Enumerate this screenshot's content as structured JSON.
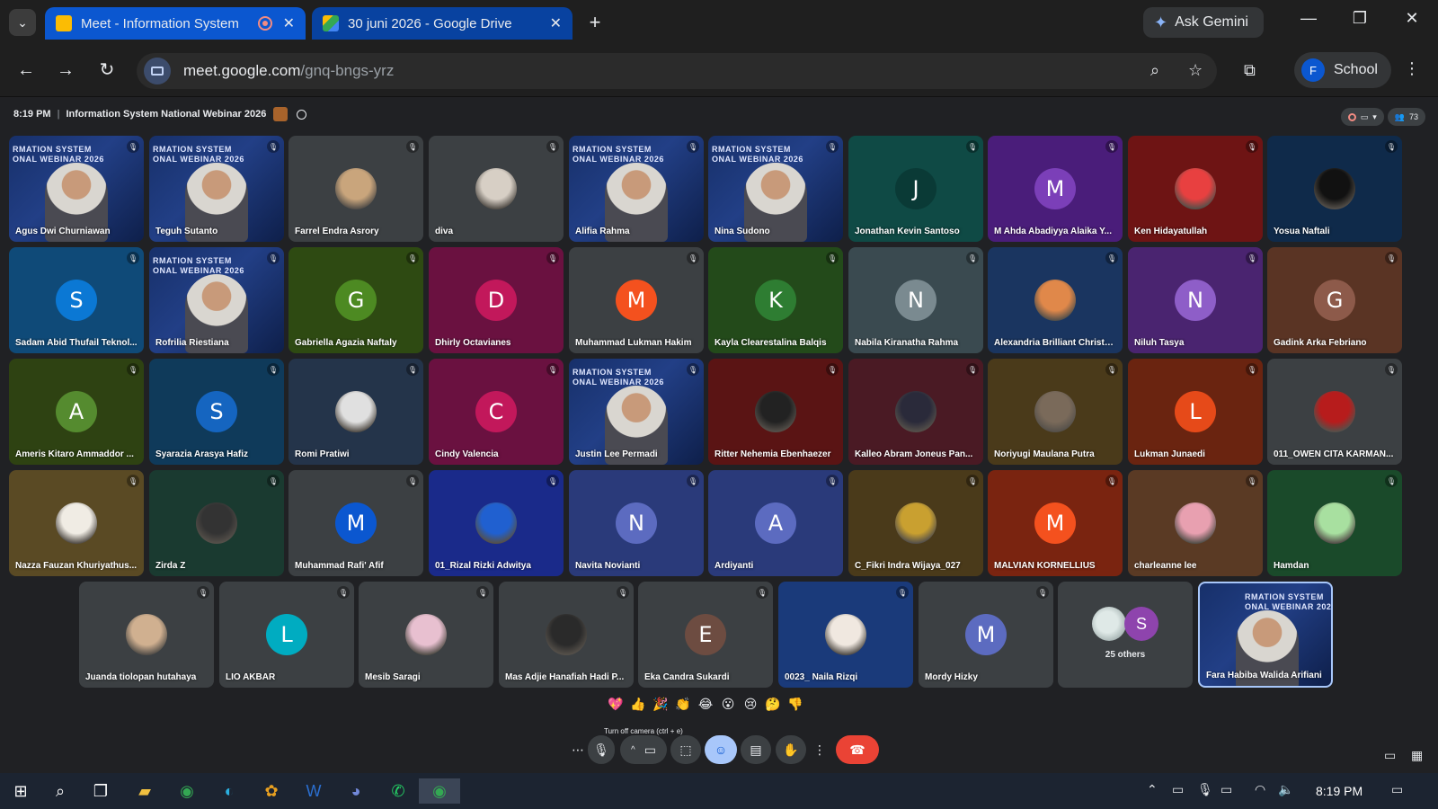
{
  "browser": {
    "tabs": [
      {
        "title": "Meet - Information System",
        "favicon_color": "#fbbc04"
      },
      {
        "title": "30 juni 2026 - Google Drive",
        "favicon_color": "#34a853"
      }
    ],
    "ask_gemini": "Ask Gemini",
    "url_host": "meet.google.com",
    "url_path": "/gnq-bngs-yrz",
    "profile_initial": "F",
    "profile_name": "School",
    "icons": {
      "back": "←",
      "forward": "→",
      "reload": "↻",
      "zoom": "⌕",
      "star": "☆",
      "extensions": "⧉",
      "menu": "⋮",
      "close": "✕",
      "newtab": "+",
      "minimize": "—",
      "restore": "❐"
    }
  },
  "meeting": {
    "time": "8:19 PM",
    "title": "Information System National Webinar 2026",
    "participant_count": "73"
  },
  "video_banner": "RMATION SYSTEM\nONAL WEBINAR 2026",
  "tiles": [
    {
      "name": "Agus Dwi Churniawan",
      "type": "video",
      "bg": "#1d3a7a"
    },
    {
      "name": "Teguh Sutanto",
      "type": "video",
      "bg": "#1d3a7a"
    },
    {
      "name": "Farrel Endra Asrory",
      "type": "photo",
      "bg": "#3c4043",
      "color": "#c9a57c"
    },
    {
      "name": "diva",
      "type": "photo",
      "bg": "#3c4043",
      "color": "#d7cfc5"
    },
    {
      "name": "Alifia Rahma",
      "type": "video",
      "bg": "#1d3a7a"
    },
    {
      "name": "Nina Sudono",
      "type": "video",
      "bg": "#1d3a7a"
    },
    {
      "name": "Jonathan Kevin Santoso",
      "type": "letter",
      "letter": "J",
      "bg": "#0f4a45",
      "color": "#0a3a36"
    },
    {
      "name": "M Ahda Abadiyya Alaika Y...",
      "type": "letter",
      "letter": "M",
      "bg": "#4a1d7a",
      "color": "#7b3fb8"
    },
    {
      "name": "Ken Hidayatullah",
      "type": "photo",
      "bg": "#6e1414",
      "color": "#e84040"
    },
    {
      "name": "Yosua Naftali",
      "type": "photo",
      "bg": "#0f2a4a",
      "color": "#111111"
    },
    {
      "name": "Sadam Abid Thufail Teknol...",
      "type": "letter",
      "letter": "S",
      "bg": "#0f4a78",
      "color": "#0b78d4"
    },
    {
      "name": "Rofrilia Riestiana",
      "type": "video",
      "bg": "#1d3a7a"
    },
    {
      "name": "Gabriella Agazia Naftaly",
      "type": "letter",
      "letter": "G",
      "bg": "#2e4a12",
      "color": "#4d8a22"
    },
    {
      "name": "Dhirly Octavianes",
      "type": "letter",
      "letter": "D",
      "bg": "#6a1140",
      "color": "#c2185b"
    },
    {
      "name": "Muhammad Lukman Hakim",
      "type": "letter",
      "letter": "M",
      "bg": "#3c4043",
      "color": "#f4511e"
    },
    {
      "name": "Kayla Clearestalina Balqis",
      "type": "letter",
      "letter": "K",
      "bg": "#234a1a",
      "color": "#2e7d32"
    },
    {
      "name": "Nabila Kiranatha Rahma",
      "type": "letter",
      "letter": "N",
      "bg": "#3a4a50",
      "color": "#7a8a90"
    },
    {
      "name": "Alexandria Brilliant Christo...",
      "type": "photo",
      "bg": "#1a3560",
      "color": "#e0884a"
    },
    {
      "name": "Niluh Tasya",
      "type": "letter",
      "letter": "N",
      "bg": "#4a2470",
      "color": "#8e5ec8"
    },
    {
      "name": "Gadink Arka Febriano",
      "type": "letter",
      "letter": "G",
      "bg": "#5a3424",
      "color": "#8d5a4a"
    },
    {
      "name": "Ameris Kitaro Ammaddor ...",
      "type": "letter",
      "letter": "A",
      "bg": "#2e4212",
      "color": "#558b2f"
    },
    {
      "name": "Syarazia Arasya Hafiz",
      "type": "letter",
      "letter": "S",
      "bg": "#0f3a5a",
      "color": "#1565c0"
    },
    {
      "name": "Romi Pratiwi",
      "type": "photo",
      "bg": "#24344a",
      "color": "#e0e0e0"
    },
    {
      "name": "Cindy Valencia",
      "type": "letter",
      "letter": "C",
      "bg": "#6a1140",
      "color": "#c2185b"
    },
    {
      "name": "Justin Lee Permadi",
      "type": "video",
      "bg": "#1d3a7a"
    },
    {
      "name": "Ritter Nehemia Ebenhaezer",
      "type": "photo",
      "bg": "#5a1414",
      "color": "#222222"
    },
    {
      "name": "Kalleo Abram Joneus Pan...",
      "type": "photo",
      "bg": "#4a1a24",
      "color": "#2a2a3a"
    },
    {
      "name": "Noriyugi Maulana Putra",
      "type": "photo",
      "bg": "#4a3a1a",
      "color": "#7a6a5a"
    },
    {
      "name": "Lukman Junaedi",
      "type": "letter",
      "letter": "L",
      "bg": "#6a2410",
      "color": "#e64a19"
    },
    {
      "name": "011_OWEN CITA KARMAN...",
      "type": "photo",
      "bg": "#3c4043",
      "color": "#b71c1c"
    },
    {
      "name": "Nazza Fauzan Khuriyathus...",
      "type": "photo",
      "bg": "#5a4a24",
      "color": "#f0ece4"
    },
    {
      "name": "Zirda Z",
      "type": "photo",
      "bg": "#1a3a30",
      "color": "#333333"
    },
    {
      "name": "Muhammad Rafi' Afif",
      "type": "letter",
      "letter": "M",
      "bg": "#3c4043",
      "color": "#0b57d0"
    },
    {
      "name": "01_Rizal Rizki Adwitya",
      "type": "photo",
      "bg": "#1a2a8a",
      "color": "#2060d0"
    },
    {
      "name": "Navita Novianti",
      "type": "letter",
      "letter": "N",
      "bg": "#2a3a7a",
      "color": "#5c6bc0"
    },
    {
      "name": "Ardiyanti",
      "type": "letter",
      "letter": "A",
      "bg": "#2a3a7a",
      "color": "#5c6bc0"
    },
    {
      "name": "C_Fikri Indra Wijaya_027",
      "type": "photo",
      "bg": "#4a3a1a",
      "color": "#c9a030"
    },
    {
      "name": "MALVIAN KORNELLIUS",
      "type": "letter",
      "letter": "M",
      "bg": "#7a2410",
      "color": "#f4511e"
    },
    {
      "name": "charleanne lee",
      "type": "photo",
      "bg": "#5a3a24",
      "color": "#e8a0b0"
    },
    {
      "name": "Hamdan",
      "type": "photo",
      "bg": "#1a4a2a",
      "color": "#a8e0a0"
    },
    {
      "name": "Juanda tiolopan hutahaya",
      "type": "photo",
      "bg": "#3c4043",
      "color": "#d0b090"
    },
    {
      "name": "LIO AKBAR",
      "type": "letter",
      "letter": "L",
      "bg": "#3c4043",
      "color": "#00acc1"
    },
    {
      "name": "Mesib Saragi",
      "type": "photo",
      "bg": "#3c4043",
      "color": "#e8c0d0"
    },
    {
      "name": "Mas Adjie Hanafiah Hadi P...",
      "type": "photo",
      "bg": "#3c4043",
      "color": "#2a2a2a"
    },
    {
      "name": "Eka Candra Sukardi",
      "type": "letter",
      "letter": "E",
      "bg": "#3c4043",
      "color": "#6d4c41"
    },
    {
      "name": "0023_ Naila Rizqi",
      "type": "photo",
      "bg": "#1a3a7a",
      "color": "#f0e8e0"
    },
    {
      "name": "Mordy Hizky",
      "type": "letter",
      "letter": "M",
      "bg": "#3c4043",
      "color": "#5c6bc0"
    }
  ],
  "others": {
    "label": "25 others",
    "letter": "S"
  },
  "self_tile": {
    "name": "Fara Habiba Walida Arifiani"
  },
  "reactions": [
    "💖",
    "👍",
    "🎉",
    "👏",
    "😂",
    "😮",
    "😢",
    "🤔",
    "👎"
  ],
  "tooltip": "Turn off camera (ctrl + e)",
  "controls": {
    "more": "⋯",
    "mic": "🎙",
    "caret": "^",
    "camera": "▭",
    "present": "⬚",
    "emoji": "☺",
    "captions": "▤",
    "raise_hand": "✋",
    "options": "⋮",
    "end_call": "☎"
  },
  "taskbar": {
    "time": "8:19 PM",
    "apps": [
      "start",
      "search",
      "task-view",
      "files",
      "chrome",
      "edge",
      "photos",
      "word",
      "discord",
      "whatsapp",
      "chrome-active"
    ]
  }
}
